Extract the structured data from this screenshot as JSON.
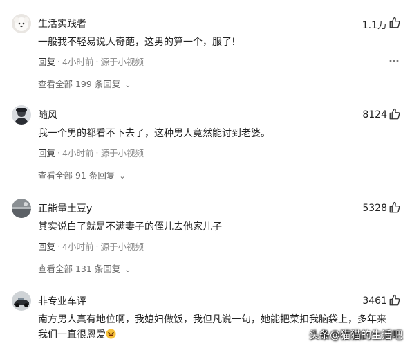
{
  "comments": [
    {
      "username": "生活实践者",
      "likes": "1.1万",
      "content": "一般我不轻易说人奇葩，这男的算一个，服了!",
      "reply": "回复",
      "time": "4小时前",
      "source": "源于小视频",
      "view_replies": "查看全部 199 条回复"
    },
    {
      "username": "随风",
      "likes": "8124",
      "content": "我一个男的都看不下去了，这种男人竟然能讨到老婆。",
      "reply": "回复",
      "time": "4小时前",
      "source": "源于小视频",
      "view_replies": "查看全部 91 条回复"
    },
    {
      "username": "正能量土豆y",
      "likes": "5328",
      "content": "其实说白了就是不满妻子的侄儿去他家儿子",
      "reply": "回复",
      "time": "4小时前",
      "source": "源于小视频",
      "view_replies": "查看全部 131 条回复"
    },
    {
      "username": "非专业车评",
      "likes": "3461",
      "content": "南方男人真有地位啊，我媳妇做饭，我但凡说一句，她能把菜扣我脑袋上，多年来我们一直很恩爱"
    }
  ],
  "icons": {
    "like": "thumbs-up-icon",
    "comment": "comment-bubble-icon",
    "more": "more-horizontal-icon",
    "emoji": "laughing-face-emoji"
  },
  "watermark": "头条@猫猫的生活吧"
}
